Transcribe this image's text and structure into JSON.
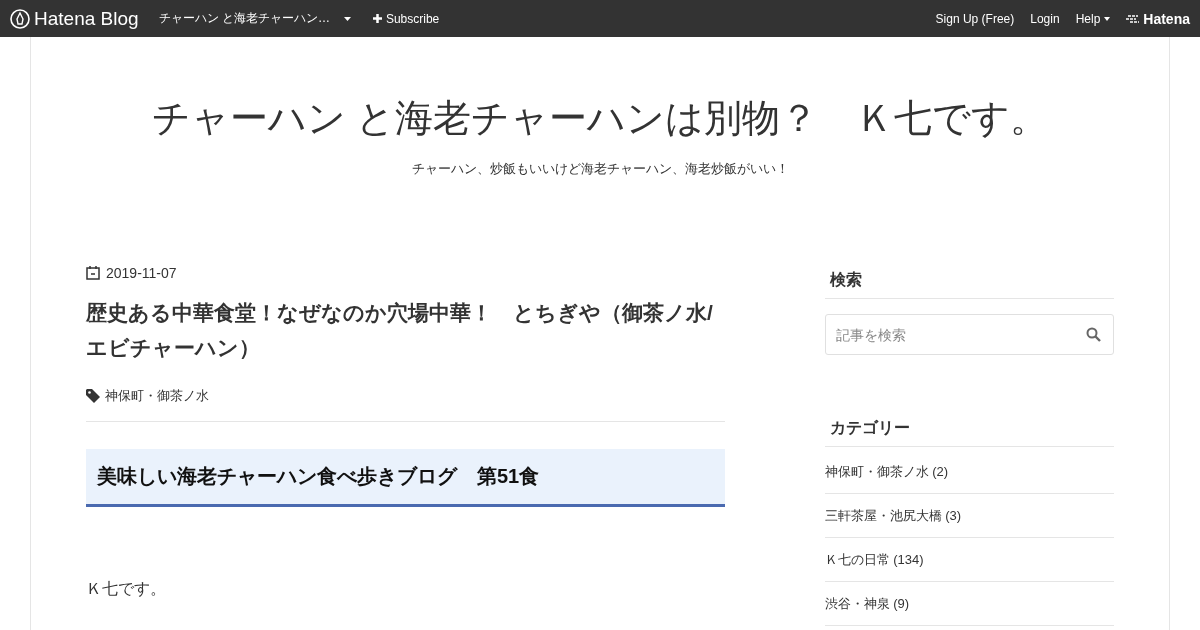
{
  "top_bar": {
    "logo": "Hatena Blog",
    "blog_menu": "チャーハン と海老チャーハン…",
    "subscribe": "Subscribe",
    "links": [
      "Sign Up (Free)",
      "Login",
      "Help"
    ],
    "brand": "Hatena"
  },
  "header": {
    "title": "チャーハン と海老チャーハンは別物？　Ｋ七です。",
    "description": "チャーハン、炒飯もいいけど海老チャーハン、海老炒飯がいい！"
  },
  "article": {
    "date": "2019-11-07",
    "title": "歴史ある中華食堂！なぜなのか穴場中華！　とちぎや（御茶ノ水/エビチャーハン）",
    "tags": [
      "神保町・御茶ノ水"
    ],
    "heading": "美味しい海老チャーハン食べ歩きブログ　第51食",
    "body": "Ｋ七です。"
  },
  "sidebar": {
    "search": {
      "title": "検索",
      "placeholder": "記事を検索"
    },
    "categories": {
      "title": "カテゴリー",
      "items": [
        {
          "label": "神保町・御茶ノ水 (2)"
        },
        {
          "label": "三軒茶屋・池尻大橋 (3)"
        },
        {
          "label": "Ｋ七の日常 (134)"
        },
        {
          "label": "渋谷・神泉 (9)"
        }
      ]
    }
  }
}
